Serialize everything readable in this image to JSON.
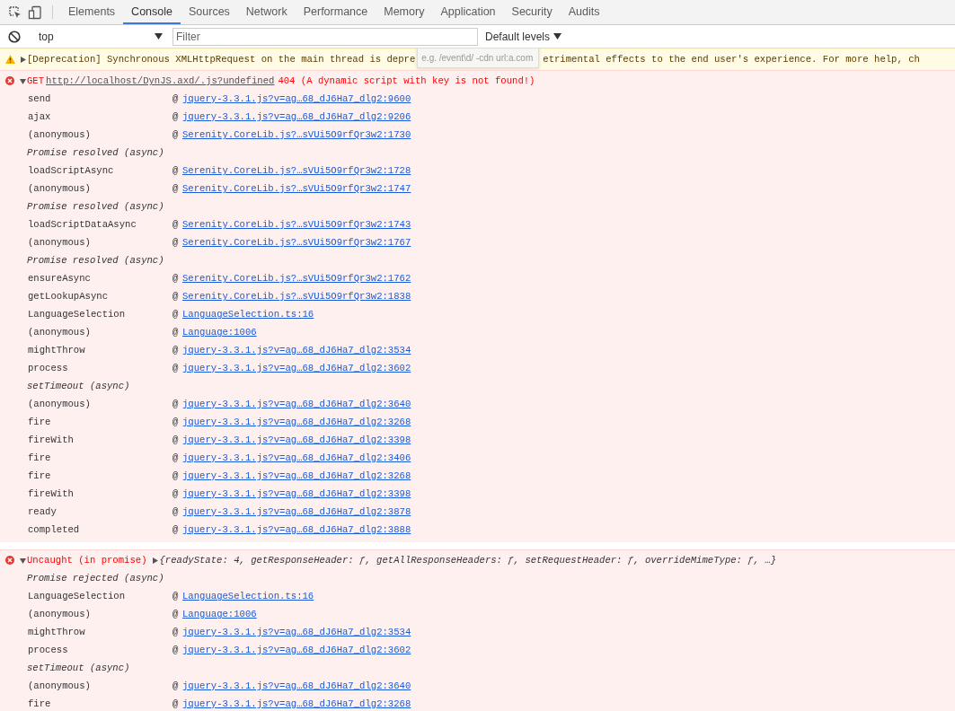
{
  "tabs": [
    {
      "label": "Elements",
      "selected": false
    },
    {
      "label": "Console",
      "selected": true
    },
    {
      "label": "Sources",
      "selected": false
    },
    {
      "label": "Network",
      "selected": false
    },
    {
      "label": "Performance",
      "selected": false
    },
    {
      "label": "Memory",
      "selected": false
    },
    {
      "label": "Application",
      "selected": false
    },
    {
      "label": "Security",
      "selected": false
    },
    {
      "label": "Audits",
      "selected": false
    }
  ],
  "console_toolbar": {
    "context": "top",
    "filter": {
      "placeholder": "Filter"
    },
    "levels": "Default levels",
    "tooltip": "e.g. /event\\d/ -cdn url:a.com"
  },
  "messages": [
    {
      "kind": "warning",
      "expanded": false,
      "text": "[Deprecation] Synchronous XMLHttpRequest on the main thread is depre",
      "text_after": "etrimental effects to the end user's experience. For more help, ch"
    },
    {
      "kind": "request",
      "expanded": true,
      "method": "GET",
      "url": "http://localhost/DynJS.axd/.js?undefined",
      "status": "404 (A dynamic script with key  is not found!)",
      "frames": [
        {
          "kind": "frame",
          "name": "send",
          "at": "@",
          "link": "jquery-3.3.1.js?v=ag…68_dJ6Ha7_dlg2:9600"
        },
        {
          "kind": "frame",
          "name": "ajax",
          "at": "@",
          "link": "jquery-3.3.1.js?v=ag…68_dJ6Ha7_dlg2:9206"
        },
        {
          "kind": "frame",
          "name": "(anonymous)",
          "at": "@",
          "link": "Serenity.CoreLib.js?…sVUi5O9rfQr3w2:1730"
        },
        {
          "kind": "async",
          "name": "Promise resolved (async)"
        },
        {
          "kind": "frame",
          "name": "loadScriptAsync",
          "at": "@",
          "link": "Serenity.CoreLib.js?…sVUi5O9rfQr3w2:1728"
        },
        {
          "kind": "frame",
          "name": "(anonymous)",
          "at": "@",
          "link": "Serenity.CoreLib.js?…sVUi5O9rfQr3w2:1747"
        },
        {
          "kind": "async",
          "name": "Promise resolved (async)"
        },
        {
          "kind": "frame",
          "name": "loadScriptDataAsync",
          "at": "@",
          "link": "Serenity.CoreLib.js?…sVUi5O9rfQr3w2:1743"
        },
        {
          "kind": "frame",
          "name": "(anonymous)",
          "at": "@",
          "link": "Serenity.CoreLib.js?…sVUi5O9rfQr3w2:1767"
        },
        {
          "kind": "async",
          "name": "Promise resolved (async)"
        },
        {
          "kind": "frame",
          "name": "ensureAsync",
          "at": "@",
          "link": "Serenity.CoreLib.js?…sVUi5O9rfQr3w2:1762"
        },
        {
          "kind": "frame",
          "name": "getLookupAsync",
          "at": "@",
          "link": "Serenity.CoreLib.js?…sVUi5O9rfQr3w2:1838"
        },
        {
          "kind": "frame",
          "name": "LanguageSelection",
          "at": "@",
          "link": "LanguageSelection.ts:16"
        },
        {
          "kind": "frame",
          "name": "(anonymous)",
          "at": "@",
          "link": "Language:1006"
        },
        {
          "kind": "frame",
          "name": "mightThrow",
          "at": "@",
          "link": "jquery-3.3.1.js?v=ag…68_dJ6Ha7_dlg2:3534"
        },
        {
          "kind": "frame",
          "name": "process",
          "at": "@",
          "link": "jquery-3.3.1.js?v=ag…68_dJ6Ha7_dlg2:3602"
        },
        {
          "kind": "async",
          "name": "setTimeout (async)"
        },
        {
          "kind": "frame",
          "name": "(anonymous)",
          "at": "@",
          "link": "jquery-3.3.1.js?v=ag…68_dJ6Ha7_dlg2:3640"
        },
        {
          "kind": "frame",
          "name": "fire",
          "at": "@",
          "link": "jquery-3.3.1.js?v=ag…68_dJ6Ha7_dlg2:3268"
        },
        {
          "kind": "frame",
          "name": "fireWith",
          "at": "@",
          "link": "jquery-3.3.1.js?v=ag…68_dJ6Ha7_dlg2:3398"
        },
        {
          "kind": "frame",
          "name": "fire",
          "at": "@",
          "link": "jquery-3.3.1.js?v=ag…68_dJ6Ha7_dlg2:3406"
        },
        {
          "kind": "frame",
          "name": "fire",
          "at": "@",
          "link": "jquery-3.3.1.js?v=ag…68_dJ6Ha7_dlg2:3268"
        },
        {
          "kind": "frame",
          "name": "fireWith",
          "at": "@",
          "link": "jquery-3.3.1.js?v=ag…68_dJ6Ha7_dlg2:3398"
        },
        {
          "kind": "frame",
          "name": "ready",
          "at": "@",
          "link": "jquery-3.3.1.js?v=ag…68_dJ6Ha7_dlg2:3878"
        },
        {
          "kind": "frame",
          "name": "completed",
          "at": "@",
          "link": "jquery-3.3.1.js?v=ag…68_dJ6Ha7_dlg2:3888"
        }
      ]
    },
    {
      "kind": "exception",
      "expanded": true,
      "label": "Uncaught (in promise)",
      "object_expanded": false,
      "object": "{readyState: 4, getResponseHeader: ƒ, getAllResponseHeaders: ƒ, setRequestHeader: ƒ, overrideMimeType: ƒ, …}",
      "frames": [
        {
          "kind": "async",
          "name": "Promise rejected (async)"
        },
        {
          "kind": "frame",
          "name": "LanguageSelection",
          "at": "@",
          "link": "LanguageSelection.ts:16"
        },
        {
          "kind": "frame",
          "name": "(anonymous)",
          "at": "@",
          "link": "Language:1006"
        },
        {
          "kind": "frame",
          "name": "mightThrow",
          "at": "@",
          "link": "jquery-3.3.1.js?v=ag…68_dJ6Ha7_dlg2:3534"
        },
        {
          "kind": "frame",
          "name": "process",
          "at": "@",
          "link": "jquery-3.3.1.js?v=ag…68_dJ6Ha7_dlg2:3602"
        },
        {
          "kind": "async",
          "name": "setTimeout (async)"
        },
        {
          "kind": "frame",
          "name": "(anonymous)",
          "at": "@",
          "link": "jquery-3.3.1.js?v=ag…68_dJ6Ha7_dlg2:3640"
        },
        {
          "kind": "frame",
          "name": "fire",
          "at": "@",
          "link": "jquery-3.3.1.js?v=ag…68_dJ6Ha7_dlg2:3268"
        }
      ]
    }
  ]
}
